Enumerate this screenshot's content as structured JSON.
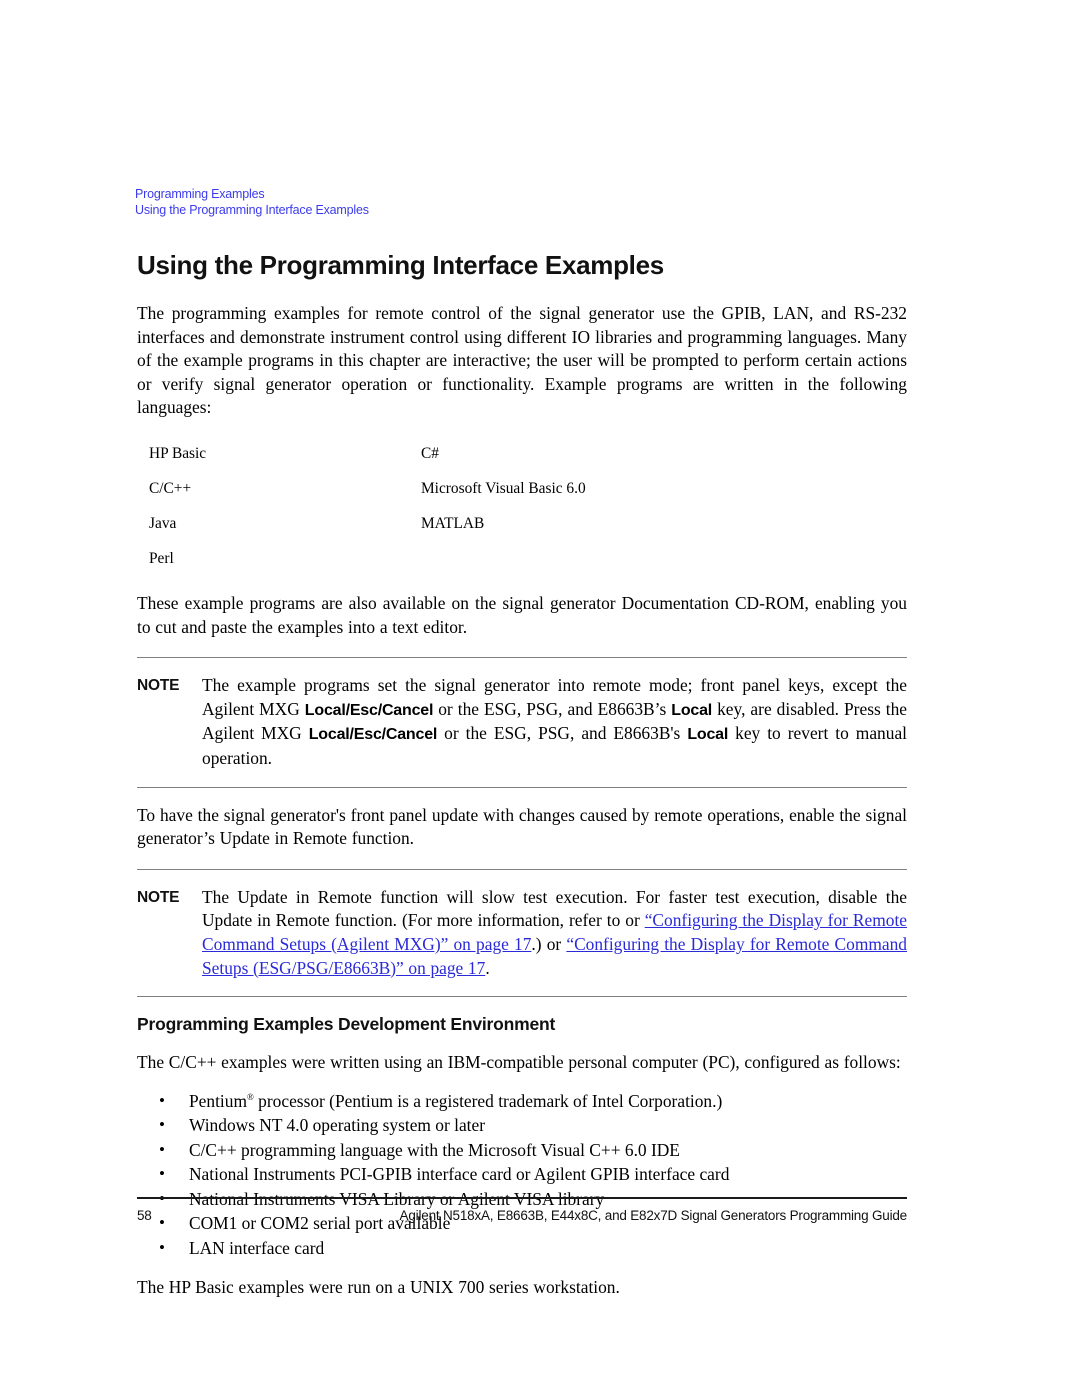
{
  "running_header": {
    "line1": "Programming Examples",
    "line2": "Using the Programming Interface Examples",
    "color": "#3b3bee"
  },
  "chapter_title": "Using the Programming Interface Examples",
  "intro_paragraph": "The programming examples for remote control of the signal generator use the GPIB, LAN, and RS-232 interfaces and demonstrate instrument control using different IO libraries and programming languages. Many of the example programs in this chapter are interactive; the user will be prompted to perform certain actions or verify signal generator operation or functionality. Example programs are written in the following languages:",
  "language_table": {
    "rows": [
      {
        "col_a": "HP Basic",
        "col_b": "C#"
      },
      {
        "col_a": "C/C++",
        "col_b": "Microsoft Visual Basic 6.0"
      },
      {
        "col_a": "Java",
        "col_b": "MATLAB"
      },
      {
        "col_a": "Perl",
        "col_b": ""
      }
    ]
  },
  "cdrom_paragraph": "These example programs are also available on the signal generator Documentation CD-ROM, enabling you to cut and paste the examples into a text editor.",
  "note1": {
    "label": "NOTE",
    "part1": "The example programs set the signal generator into remote mode; front panel keys, except the Agilent MXG ",
    "key1": "Local/Esc/Cancel",
    "part2": " or the ESG, PSG, and E8663B’s ",
    "key2": "Local",
    "part3": " key, are disabled. Press the Agilent MXG ",
    "key3": "Local/Esc/Cancel",
    "part4": " or the ESG, PSG, and E8663B's ",
    "key4": "Local",
    "part5": " key to revert to manual operation."
  },
  "update_paragraph": "To have the signal generator's front panel update with changes caused by remote operations, enable the signal generator’s Update in Remote function.",
  "note2": {
    "label": "NOTE",
    "part1": "The Update in Remote function will slow test execution. For faster test execution, disable the Update in Remote function. (For more information, refer to or ",
    "link1": "“Configuring the Display for Remote Command Setups (Agilent MXG)” on page 17",
    "part2": ".) or ",
    "link2": "“Configuring the Display for Remote Command Setups (ESG/PSG/E8663B)” on page 17",
    "part3": "."
  },
  "section_title": "Programming Examples Development Environment",
  "dev_paragraph": "The C/C++ examples were written using an IBM-compatible personal computer (PC), configured as follows:",
  "bullets": [
    {
      "text_before": "Pentium",
      "superscript": "®",
      "text_after": " processor (Pentium is a registered trademark of Intel Corporation.)"
    },
    {
      "text_before": "Windows NT 4.0 operating system or later",
      "superscript": "",
      "text_after": ""
    },
    {
      "text_before": "C/C++ programming language with the Microsoft Visual C++ 6.0 IDE",
      "superscript": "",
      "text_after": ""
    },
    {
      "text_before": "National Instruments PCI-GPIB interface card or Agilent GPIB interface card",
      "superscript": "",
      "text_after": ""
    },
    {
      "text_before": "National Instruments VISA Library or Agilent VISA library",
      "superscript": "",
      "text_after": ""
    },
    {
      "text_before": "COM1 or COM2 serial port available",
      "superscript": "",
      "text_after": ""
    },
    {
      "text_before": "LAN interface card",
      "superscript": "",
      "text_after": ""
    }
  ],
  "bullet_glyph": "•",
  "hp_basic_paragraph": "The HP Basic examples were run on a UNIX 700 series workstation.",
  "footer": {
    "page_number": "58",
    "guide_title": "Agilent N518xA, E8663B, E44x8C, and E82x7D Signal Generators Programming Guide"
  },
  "colors": {
    "link": "#2a2ad8",
    "header": "#3b3bee",
    "rule_gray": "#808080",
    "rule_black": "#1a1a1a"
  }
}
